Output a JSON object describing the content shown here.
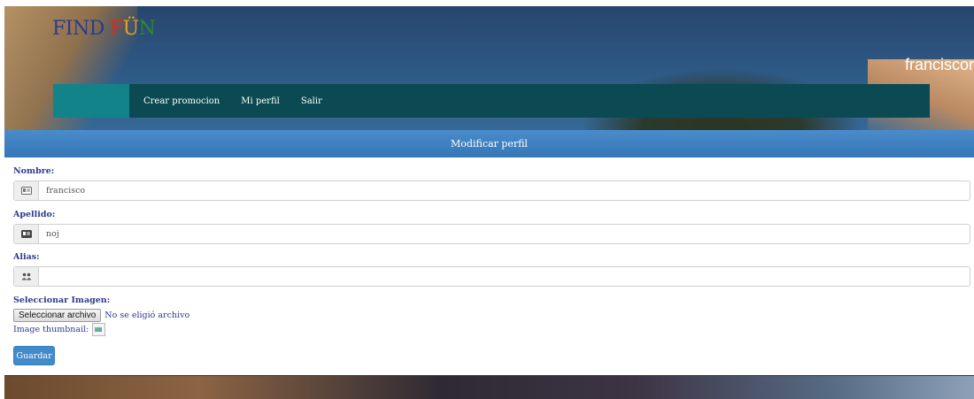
{
  "brand": {
    "letters": [
      {
        "ch": "F",
        "color": "#2d3a8c"
      },
      {
        "ch": "I",
        "color": "#2d3a8c"
      },
      {
        "ch": "N",
        "color": "#2d3a8c"
      },
      {
        "ch": "D",
        "color": "#2d3a8c"
      },
      {
        "ch": " ",
        "color": "#2d3a8c"
      },
      {
        "ch": "F",
        "color": "#e02a1a"
      },
      {
        "ch": "Ü",
        "color": "#e8a21a"
      },
      {
        "ch": "N",
        "color": "#2e8a2e"
      }
    ]
  },
  "header": {
    "username": "franciscor"
  },
  "nav": {
    "items": [
      {
        "label": "Crear promocion"
      },
      {
        "label": "Mi perfil"
      },
      {
        "label": "Salir"
      }
    ]
  },
  "panel": {
    "title": "Modificar perfil"
  },
  "form": {
    "nombre_label": "Nombre:",
    "nombre_value": "francisco",
    "apellido_label": "Apellido:",
    "apellido_value": "noj",
    "alias_label": "Alias:",
    "alias_value": "",
    "imagen_label": "Seleccionar Imagen:",
    "file_button": "Seleccionar archivo",
    "file_status": "No se eligió archivo",
    "thumbnail_label": "Image thumbnail:",
    "save_label": "Guardar"
  },
  "colors": {
    "nav_bg": "#0b4a52",
    "nav_active": "#13838a",
    "panel_header": "#3c80c0",
    "label_text": "#2d3a8c",
    "primary_button": "#428bca"
  },
  "icons": {
    "nombre": "id-card-icon",
    "apellido": "id-card-icon",
    "alias": "users-icon",
    "thumbnail": "broken-image-icon"
  }
}
